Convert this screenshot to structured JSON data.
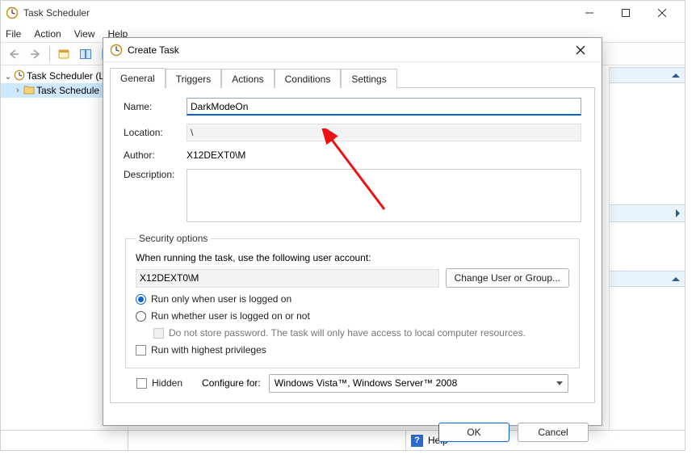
{
  "window": {
    "title": "Task Scheduler",
    "menu": [
      "File",
      "Action",
      "View",
      "Help"
    ],
    "min_tip": "Minimize",
    "max_tip": "Maximize",
    "close_tip": "Close"
  },
  "tree": {
    "root_label": "Task Scheduler (L",
    "child_label": "Task Schedule"
  },
  "status": {
    "help_label": "Help"
  },
  "dialog": {
    "title": "Create Task",
    "tabs": [
      "General",
      "Triggers",
      "Actions",
      "Conditions",
      "Settings"
    ],
    "active_tab": 0,
    "name_label": "Name:",
    "name_value": "DarkModeOn",
    "location_label": "Location:",
    "location_value": "\\",
    "author_label": "Author:",
    "author_value": "X12DEXT0\\M",
    "description_label": "Description:",
    "description_value": "",
    "security_legend": "Security options",
    "security_prompt": "When running the task, use the following user account:",
    "account_value": "X12DEXT0\\M",
    "change_user_btn": "Change User or Group...",
    "radio_logged_on": "Run only when user is logged on",
    "radio_whether": "Run whether user is logged on or not",
    "dont_store_pw": "Do not store password.  The task will only have access to local computer resources.",
    "highest_priv": "Run with highest privileges",
    "hidden_label": "Hidden",
    "configure_for_label": "Configure for:",
    "configure_for_value": "Windows Vista™, Windows Server™ 2008",
    "ok_label": "OK",
    "cancel_label": "Cancel"
  }
}
